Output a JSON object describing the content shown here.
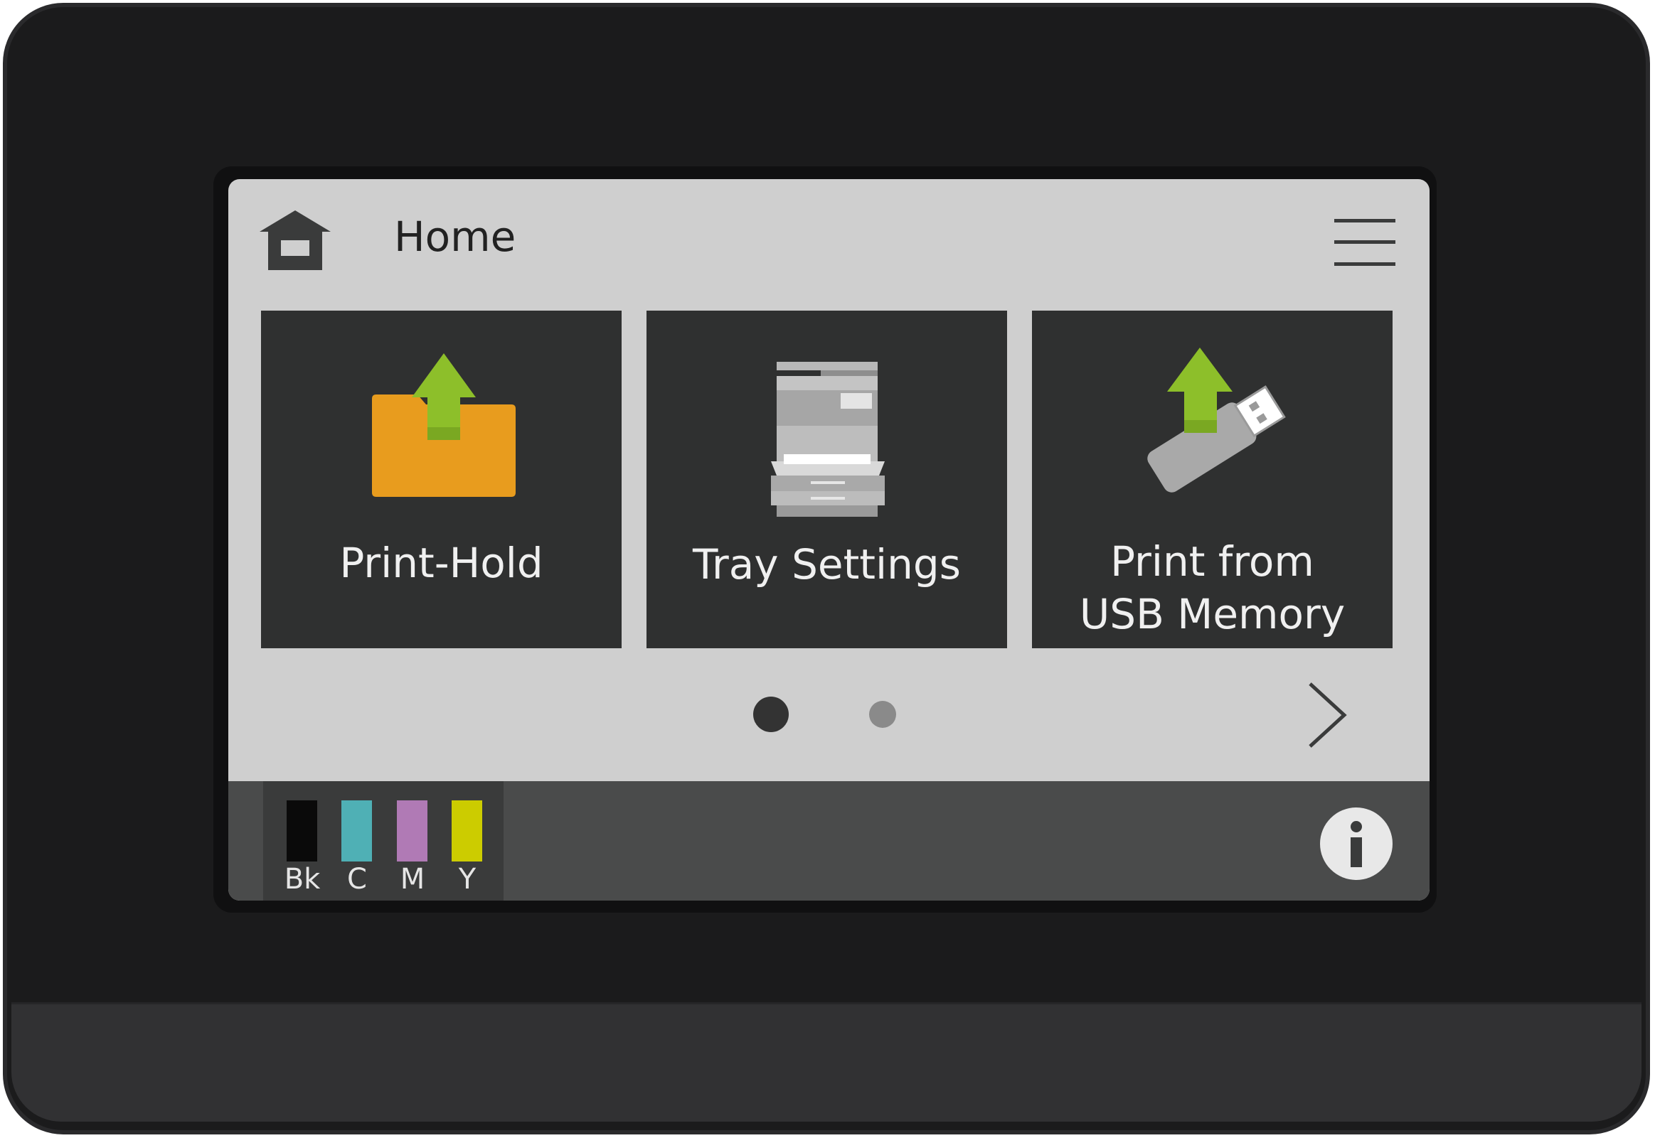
{
  "header": {
    "title": "Home",
    "home_icon": "house-icon",
    "menu_icon": "hamburger-menu-icon"
  },
  "tiles": [
    {
      "label": "Print-Hold",
      "icon": "folder-upload-icon",
      "icon_colors": {
        "folder": "#e89c1e",
        "arrow": "#8dbf2a"
      }
    },
    {
      "label": "Tray Settings",
      "icon": "printer-tray-icon"
    },
    {
      "label_line1": "Print from",
      "label_line2": "USB Memory",
      "icon": "usb-upload-icon",
      "icon_colors": {
        "usb": "#a9a9a9",
        "arrow": "#8dbf2a"
      }
    }
  ],
  "pager": {
    "pages": 2,
    "current": 1,
    "next_icon": "chevron-right-icon"
  },
  "status_bar": {
    "toner": [
      {
        "label": "Bk",
        "color": "#0a0a0a"
      },
      {
        "label": "C",
        "color": "#4fb0b5"
      },
      {
        "label": "M",
        "color": "#b07ab5"
      },
      {
        "label": "Y",
        "color": "#cccc00"
      }
    ],
    "info_icon": "info-icon"
  },
  "colors": {
    "device_body": "#1b1b1c",
    "screen_bg": "#cfcfcf",
    "tile_bg": "#2f3030",
    "status_bar_bg": "#4a4b4b"
  }
}
